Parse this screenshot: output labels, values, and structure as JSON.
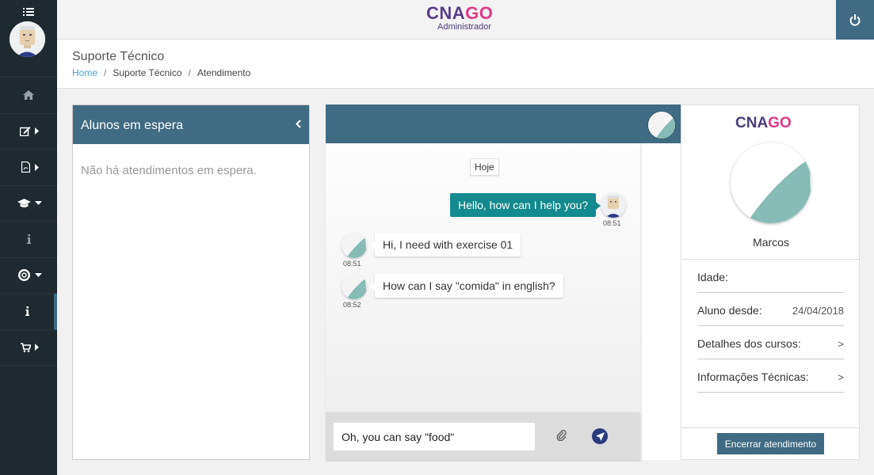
{
  "app": {
    "logo_main": "CNA",
    "logo_accent": "GO",
    "logo_sub": "Administrador"
  },
  "sidebar": {
    "items": [
      {
        "icon": "home-icon"
      },
      {
        "icon": "edit-icon",
        "caret": "right"
      },
      {
        "icon": "pdf-icon",
        "caret": "right"
      },
      {
        "icon": "graduation-cap-icon",
        "caret": "down"
      },
      {
        "icon": "info-icon"
      },
      {
        "icon": "support-icon",
        "caret": "down"
      },
      {
        "icon": "info-icon",
        "active": true
      },
      {
        "icon": "cart-icon",
        "caret": "right"
      }
    ]
  },
  "page": {
    "title": "Suporte Técnico",
    "breadcrumb": [
      "Home",
      "Suporte Técnico",
      "Atendimento"
    ]
  },
  "waiting": {
    "title": "Alunos em espera",
    "empty_text": "Não há atendimentos em espera."
  },
  "chat": {
    "day_label": "Hoje",
    "messages": [
      {
        "direction": "out",
        "text": "Hello, how can I help you?",
        "time": "08:51"
      },
      {
        "direction": "in",
        "text": "Hi, I need with exercise 01",
        "time": "08:51"
      },
      {
        "direction": "in",
        "text": "How can I say \"comida\" in english?",
        "time": "08:52"
      }
    ],
    "input_value": "Oh, you can say \"food\""
  },
  "profile": {
    "logo_main": "CNA",
    "logo_accent": "GO",
    "name": "Marcos",
    "fields": [
      {
        "label": "Idade:",
        "value": ""
      },
      {
        "label": "Aluno desde:",
        "value": "24/04/2018"
      },
      {
        "label": "Detalhes dos cursos:",
        "value": ">"
      },
      {
        "label": "Informações Técnicas:",
        "value": ">"
      }
    ],
    "end_button": "Encerrar atendimento"
  },
  "colors": {
    "accent": "#3f6b84",
    "sidebar": "#1f2a30",
    "bubble_out": "#138a8f",
    "logo_purple": "#4a3c7a",
    "logo_pink": "#e0388a"
  }
}
